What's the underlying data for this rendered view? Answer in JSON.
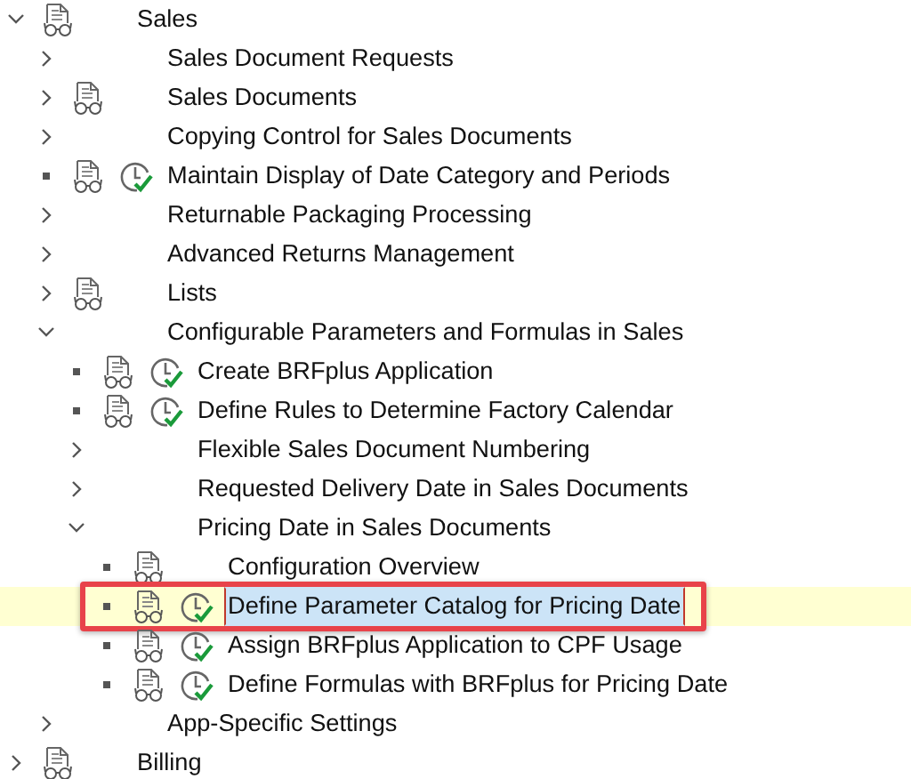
{
  "tree": [
    {
      "label": "Sales",
      "kind": "folder",
      "expanded": true,
      "doc": true,
      "activity": false,
      "selected": false,
      "children": [
        {
          "label": "Sales Document Requests",
          "kind": "folder",
          "expanded": false,
          "doc": false,
          "activity": false,
          "selected": false
        },
        {
          "label": "Sales Documents",
          "kind": "folder",
          "expanded": false,
          "doc": true,
          "activity": false,
          "selected": false
        },
        {
          "label": "Copying Control for Sales Documents",
          "kind": "folder",
          "expanded": false,
          "doc": false,
          "activity": false,
          "selected": false
        },
        {
          "label": "Maintain Display of Date Category and Periods",
          "kind": "leaf",
          "doc": true,
          "activity": true,
          "selected": false
        },
        {
          "label": "Returnable Packaging Processing",
          "kind": "folder",
          "expanded": false,
          "doc": false,
          "activity": false,
          "selected": false
        },
        {
          "label": "Advanced Returns Management",
          "kind": "folder",
          "expanded": false,
          "doc": false,
          "activity": false,
          "selected": false
        },
        {
          "label": "Lists",
          "kind": "folder",
          "expanded": false,
          "doc": true,
          "activity": false,
          "selected": false
        },
        {
          "label": "Configurable Parameters and Formulas in Sales",
          "kind": "folder",
          "expanded": true,
          "doc": false,
          "activity": false,
          "selected": false,
          "children": [
            {
              "label": "Create BRFplus Application",
              "kind": "leaf",
              "doc": true,
              "activity": true,
              "selected": false
            },
            {
              "label": "Define Rules to Determine Factory Calendar",
              "kind": "leaf",
              "doc": true,
              "activity": true,
              "selected": false
            },
            {
              "label": "Flexible Sales Document Numbering",
              "kind": "folder",
              "expanded": false,
              "doc": false,
              "activity": false,
              "selected": false
            },
            {
              "label": "Requested Delivery Date in Sales Documents",
              "kind": "folder",
              "expanded": false,
              "doc": false,
              "activity": false,
              "selected": false
            },
            {
              "label": "Pricing Date in Sales Documents",
              "kind": "folder",
              "expanded": true,
              "doc": false,
              "activity": false,
              "selected": false,
              "children": [
                {
                  "label": "Configuration Overview",
                  "kind": "leaf",
                  "doc": true,
                  "activity": false,
                  "selected": false
                },
                {
                  "label": "Define Parameter Catalog for Pricing Date",
                  "kind": "leaf",
                  "doc": true,
                  "activity": true,
                  "selected": true,
                  "annotated": true
                },
                {
                  "label": "Assign BRFplus Application to CPF Usage",
                  "kind": "leaf",
                  "doc": true,
                  "activity": true,
                  "selected": false
                },
                {
                  "label": "Define Formulas with BRFplus for Pricing Date",
                  "kind": "leaf",
                  "doc": true,
                  "activity": true,
                  "selected": false
                }
              ]
            }
          ]
        },
        {
          "label": "App-Specific Settings",
          "kind": "folder",
          "expanded": false,
          "doc": false,
          "activity": false,
          "selected": false
        }
      ]
    },
    {
      "label": "Billing",
      "kind": "folder",
      "expanded": false,
      "doc": true,
      "activity": false,
      "selected": false
    }
  ]
}
